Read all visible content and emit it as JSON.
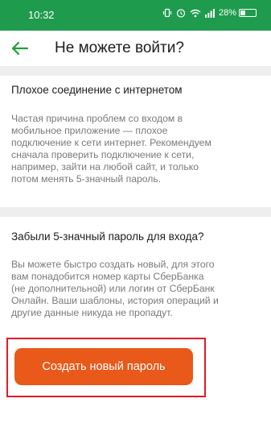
{
  "status_bar": {
    "time": "10:32",
    "battery": "28%",
    "icons": [
      "vibrate-icon",
      "alarm-icon",
      "wifi-icon",
      "signal-icon",
      "battery-icon"
    ]
  },
  "header": {
    "back_icon": "arrow-left-icon",
    "title": "Не можете войти?"
  },
  "sections": [
    {
      "title": "Плохое соединение с интернетом",
      "lines": [
        "Частая причина проблем со входом в",
        "мобильное приложение — плохое",
        "подключение к сети интернет. Рекомендуем",
        "сначала проверить подключение к сети,",
        "например, зайти на любой сайт, и только",
        "потом менять 5-значный пароль."
      ]
    },
    {
      "title": "Забыли 5-значный пароль для входа?",
      "lines": [
        "Вы можете быстро создать новый, для этого",
        "вам понадобится номер карты СберБанка",
        "(не дополнительной) или логин от СберБанк",
        "Онлайн. Ваши шаблоны, история операций и",
        "другие данные никуда не пропадут."
      ]
    }
  ],
  "create_button": {
    "label": "Создать новый пароль"
  },
  "colors": {
    "status_bar": "#1f9b4d",
    "accent_green": "#21a038",
    "button": "#e8591a",
    "highlight": "#e31b23"
  }
}
